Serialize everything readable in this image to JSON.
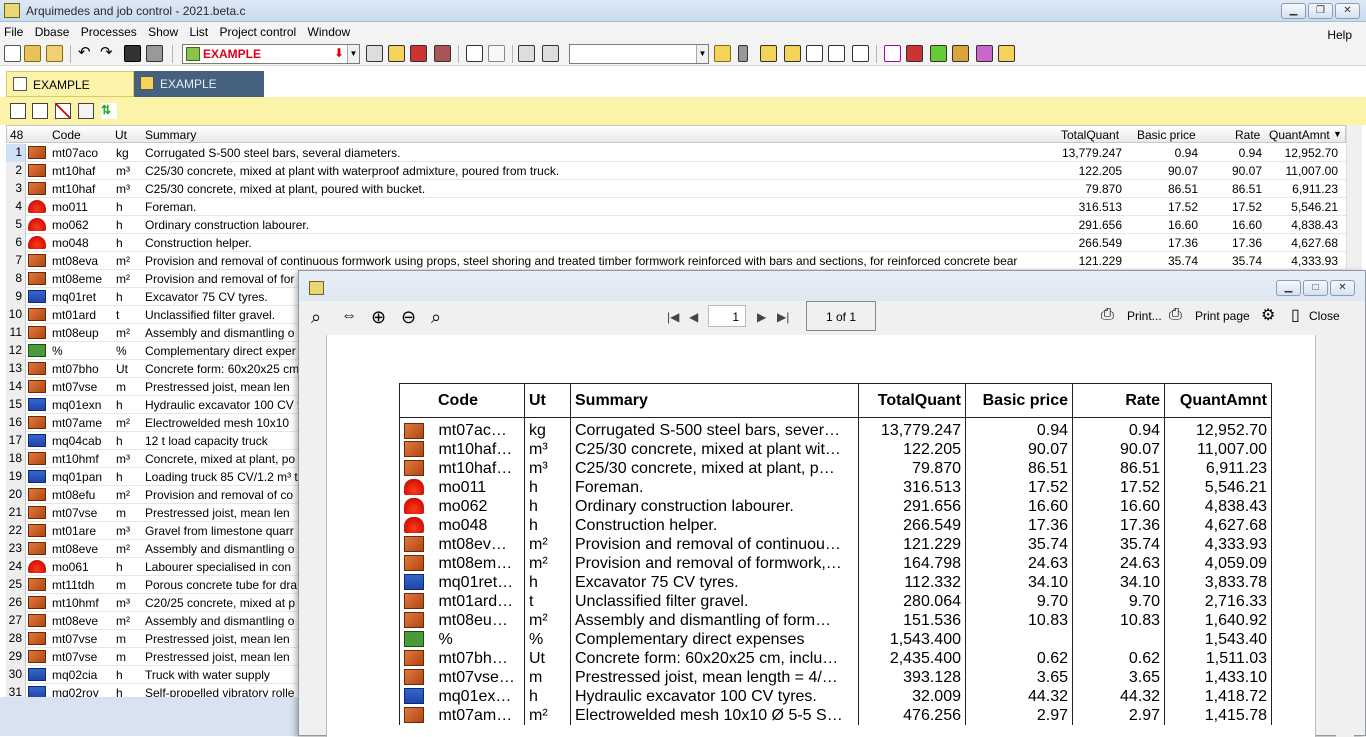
{
  "window": {
    "title": "Arquimedes and job control - 2021.beta.c"
  },
  "menu": [
    "File",
    "Dbase",
    "Processes",
    "Show",
    "List",
    "Project control",
    "Window"
  ],
  "menu_help": "Help",
  "toolbar": {
    "project_name": "EXAMPLE"
  },
  "tabs": [
    {
      "label": "EXAMPLE",
      "active": true
    },
    {
      "label": "EXAMPLE",
      "active": false
    }
  ],
  "grid": {
    "count": "48",
    "columns": [
      "Code",
      "Ut",
      "Summary",
      "TotalQuant",
      "Basic price",
      "Rate",
      "QuantAmnt"
    ],
    "rows": [
      {
        "n": "1",
        "icon": "brick",
        "code": "mt07aco",
        "ut": "kg",
        "summary": "Corrugated S-500 steel bars, several diameters.",
        "tq": "13,779.247",
        "bp": "0.94",
        "rate": "0.94",
        "qa": "12,952.70"
      },
      {
        "n": "2",
        "icon": "brick",
        "code": "mt10haf",
        "ut": "m³",
        "summary": "C25/30 concrete, mixed at plant with waterproof admixture, poured from truck.",
        "tq": "122.205",
        "bp": "90.07",
        "rate": "90.07",
        "qa": "11,007.00"
      },
      {
        "n": "3",
        "icon": "brick",
        "code": "mt10haf",
        "ut": "m³",
        "summary": "C25/30 concrete, mixed at plant, poured with bucket.",
        "tq": "79.870",
        "bp": "86.51",
        "rate": "86.51",
        "qa": "6,911.23"
      },
      {
        "n": "4",
        "icon": "helmet",
        "code": "mo011",
        "ut": "h",
        "summary": "Foreman.",
        "tq": "316.513",
        "bp": "17.52",
        "rate": "17.52",
        "qa": "5,546.21"
      },
      {
        "n": "5",
        "icon": "helmet",
        "code": "mo062",
        "ut": "h",
        "summary": "Ordinary construction labourer.",
        "tq": "291.656",
        "bp": "16.60",
        "rate": "16.60",
        "qa": "4,838.43"
      },
      {
        "n": "6",
        "icon": "helmet",
        "code": "mo048",
        "ut": "h",
        "summary": "Construction helper.",
        "tq": "266.549",
        "bp": "17.36",
        "rate": "17.36",
        "qa": "4,627.68"
      },
      {
        "n": "7",
        "icon": "brick",
        "code": "mt08eva",
        "ut": "m²",
        "summary": "Provision and removal of continuous formwork using props, steel shoring and treated timber formwork reinforced with bars and sections, for reinforced concrete bear",
        "tq": "121.229",
        "bp": "35.74",
        "rate": "35.74",
        "qa": "4,333.93"
      },
      {
        "n": "8",
        "icon": "brick",
        "code": "mt08eme",
        "ut": "m²",
        "summary": "Provision and removal of for"
      },
      {
        "n": "9",
        "icon": "truck",
        "code": "mq01ret",
        "ut": "h",
        "summary": "Excavator 75 CV tyres."
      },
      {
        "n": "10",
        "icon": "brick",
        "code": "mt01ard",
        "ut": "t",
        "summary": "Unclassified filter gravel."
      },
      {
        "n": "11",
        "icon": "brick",
        "code": "mt08eup",
        "ut": "m²",
        "summary": "Assembly and dismantling o"
      },
      {
        "n": "12",
        "icon": "pct",
        "code": "%",
        "ut": "%",
        "summary": "Complementary direct exper"
      },
      {
        "n": "13",
        "icon": "brick",
        "code": "mt07bho",
        "ut": "Ut",
        "summary": "Concrete form: 60x20x25 cm"
      },
      {
        "n": "14",
        "icon": "brick",
        "code": "mt07vse",
        "ut": "m",
        "summary": "Prestressed joist, mean len"
      },
      {
        "n": "15",
        "icon": "truck",
        "code": "mq01exn",
        "ut": "h",
        "summary": "Hydraulic excavator 100 CV t"
      },
      {
        "n": "16",
        "icon": "brick",
        "code": "mt07ame",
        "ut": "m²",
        "summary": "Electrowelded mesh 10x10"
      },
      {
        "n": "17",
        "icon": "truck",
        "code": "mq04cab",
        "ut": "h",
        "summary": "12 t load capacity truck"
      },
      {
        "n": "18",
        "icon": "brick",
        "code": "mt10hmf",
        "ut": "m³",
        "summary": "Concrete, mixed at plant, po"
      },
      {
        "n": "19",
        "icon": "truck",
        "code": "mq01pan",
        "ut": "h",
        "summary": "Loading truck 85 CV/1.2 m³ t"
      },
      {
        "n": "20",
        "icon": "brick",
        "code": "mt08efu",
        "ut": "m²",
        "summary": "Provision and removal of co"
      },
      {
        "n": "21",
        "icon": "brick",
        "code": "mt07vse",
        "ut": "m",
        "summary": "Prestressed joist, mean len"
      },
      {
        "n": "22",
        "icon": "brick",
        "code": "mt01are",
        "ut": "m³",
        "summary": "Gravel from limestone quarr"
      },
      {
        "n": "23",
        "icon": "brick",
        "code": "mt08eve",
        "ut": "m²",
        "summary": "Assembly and dismantling o"
      },
      {
        "n": "24",
        "icon": "helmet",
        "code": "mo061",
        "ut": "h",
        "summary": "Labourer specialised in con"
      },
      {
        "n": "25",
        "icon": "brick",
        "code": "mt11tdh",
        "ut": "m",
        "summary": "Porous concrete tube for dra"
      },
      {
        "n": "26",
        "icon": "brick",
        "code": "mt10hmf",
        "ut": "m³",
        "summary": "C20/25 concrete, mixed at p"
      },
      {
        "n": "27",
        "icon": "brick",
        "code": "mt08eve",
        "ut": "m²",
        "summary": "Assembly and dismantling o"
      },
      {
        "n": "28",
        "icon": "brick",
        "code": "mt07vse",
        "ut": "m",
        "summary": "Prestressed joist, mean len"
      },
      {
        "n": "29",
        "icon": "brick",
        "code": "mt07vse",
        "ut": "m",
        "summary": "Prestressed joist, mean len"
      },
      {
        "n": "30",
        "icon": "truck",
        "code": "mq02cia",
        "ut": "h",
        "summary": "Truck with water supply"
      },
      {
        "n": "31",
        "icon": "truck",
        "code": "mq02roy",
        "ut": "h",
        "summary": "Self-propelled vibratory rolle"
      }
    ]
  },
  "viewer": {
    "page": "1",
    "page_of": "1 of 1",
    "print_label": "Print...",
    "print_page_label": "Print page",
    "close_label": "Close",
    "report": {
      "columns": [
        "Code",
        "Ut",
        "Summary",
        "TotalQuant",
        "Basic price",
        "Rate",
        "QuantAmnt"
      ],
      "rows": [
        {
          "icon": "brick",
          "code": "mt07ac…",
          "ut": "kg",
          "summary": "Corrugated S-500 steel bars, sever…",
          "tq": "13,779.247",
          "bp": "0.94",
          "rate": "0.94",
          "qa": "12,952.70"
        },
        {
          "icon": "brick",
          "code": "mt10haf…",
          "ut": "m³",
          "summary": "C25/30 concrete, mixed at plant wit…",
          "tq": "122.205",
          "bp": "90.07",
          "rate": "90.07",
          "qa": "11,007.00"
        },
        {
          "icon": "brick",
          "code": "mt10haf…",
          "ut": "m³",
          "summary": "C25/30 concrete, mixed at plant, p…",
          "tq": "79.870",
          "bp": "86.51",
          "rate": "86.51",
          "qa": "6,911.23"
        },
        {
          "icon": "helmet",
          "code": "mo011",
          "ut": "h",
          "summary": "Foreman.",
          "tq": "316.513",
          "bp": "17.52",
          "rate": "17.52",
          "qa": "5,546.21"
        },
        {
          "icon": "helmet",
          "code": "mo062",
          "ut": "h",
          "summary": "Ordinary construction labourer.",
          "tq": "291.656",
          "bp": "16.60",
          "rate": "16.60",
          "qa": "4,838.43"
        },
        {
          "icon": "helmet",
          "code": "mo048",
          "ut": "h",
          "summary": "Construction helper.",
          "tq": "266.549",
          "bp": "17.36",
          "rate": "17.36",
          "qa": "4,627.68"
        },
        {
          "icon": "brick",
          "code": "mt08ev…",
          "ut": "m²",
          "summary": "Provision and removal of continuou…",
          "tq": "121.229",
          "bp": "35.74",
          "rate": "35.74",
          "qa": "4,333.93"
        },
        {
          "icon": "brick",
          "code": "mt08em…",
          "ut": "m²",
          "summary": "Provision and removal of formwork,…",
          "tq": "164.798",
          "bp": "24.63",
          "rate": "24.63",
          "qa": "4,059.09"
        },
        {
          "icon": "truck",
          "code": "mq01ret…",
          "ut": "h",
          "summary": "Excavator 75 CV tyres.",
          "tq": "112.332",
          "bp": "34.10",
          "rate": "34.10",
          "qa": "3,833.78"
        },
        {
          "icon": "brick",
          "code": "mt01ard…",
          "ut": "t",
          "summary": "Unclassified filter gravel.",
          "tq": "280.064",
          "bp": "9.70",
          "rate": "9.70",
          "qa": "2,716.33"
        },
        {
          "icon": "brick",
          "code": "mt08eu…",
          "ut": "m²",
          "summary": "Assembly and dismantling of form…",
          "tq": "151.536",
          "bp": "10.83",
          "rate": "10.83",
          "qa": "1,640.92"
        },
        {
          "icon": "pct",
          "code": "%",
          "ut": "%",
          "summary": "Complementary direct expenses",
          "tq": "1,543.400",
          "bp": "",
          "rate": "",
          "qa": "1,543.40"
        },
        {
          "icon": "brick",
          "code": "mt07bh…",
          "ut": "Ut",
          "summary": "Concrete form: 60x20x25 cm, inclu…",
          "tq": "2,435.400",
          "bp": "0.62",
          "rate": "0.62",
          "qa": "1,511.03"
        },
        {
          "icon": "brick",
          "code": "mt07vse…",
          "ut": "m",
          "summary": "Prestressed joist, mean length = 4/…",
          "tq": "393.128",
          "bp": "3.65",
          "rate": "3.65",
          "qa": "1,433.10"
        },
        {
          "icon": "truck",
          "code": "mq01ex…",
          "ut": "h",
          "summary": "Hydraulic excavator 100 CV tyres.",
          "tq": "32.009",
          "bp": "44.32",
          "rate": "44.32",
          "qa": "1,418.72"
        },
        {
          "icon": "brick",
          "code": "mt07am…",
          "ut": "m²",
          "summary": "Electrowelded mesh 10x10 Ø 5-5 S…",
          "tq": "476.256",
          "bp": "2.97",
          "rate": "2.97",
          "qa": "1,415.78"
        }
      ]
    }
  }
}
